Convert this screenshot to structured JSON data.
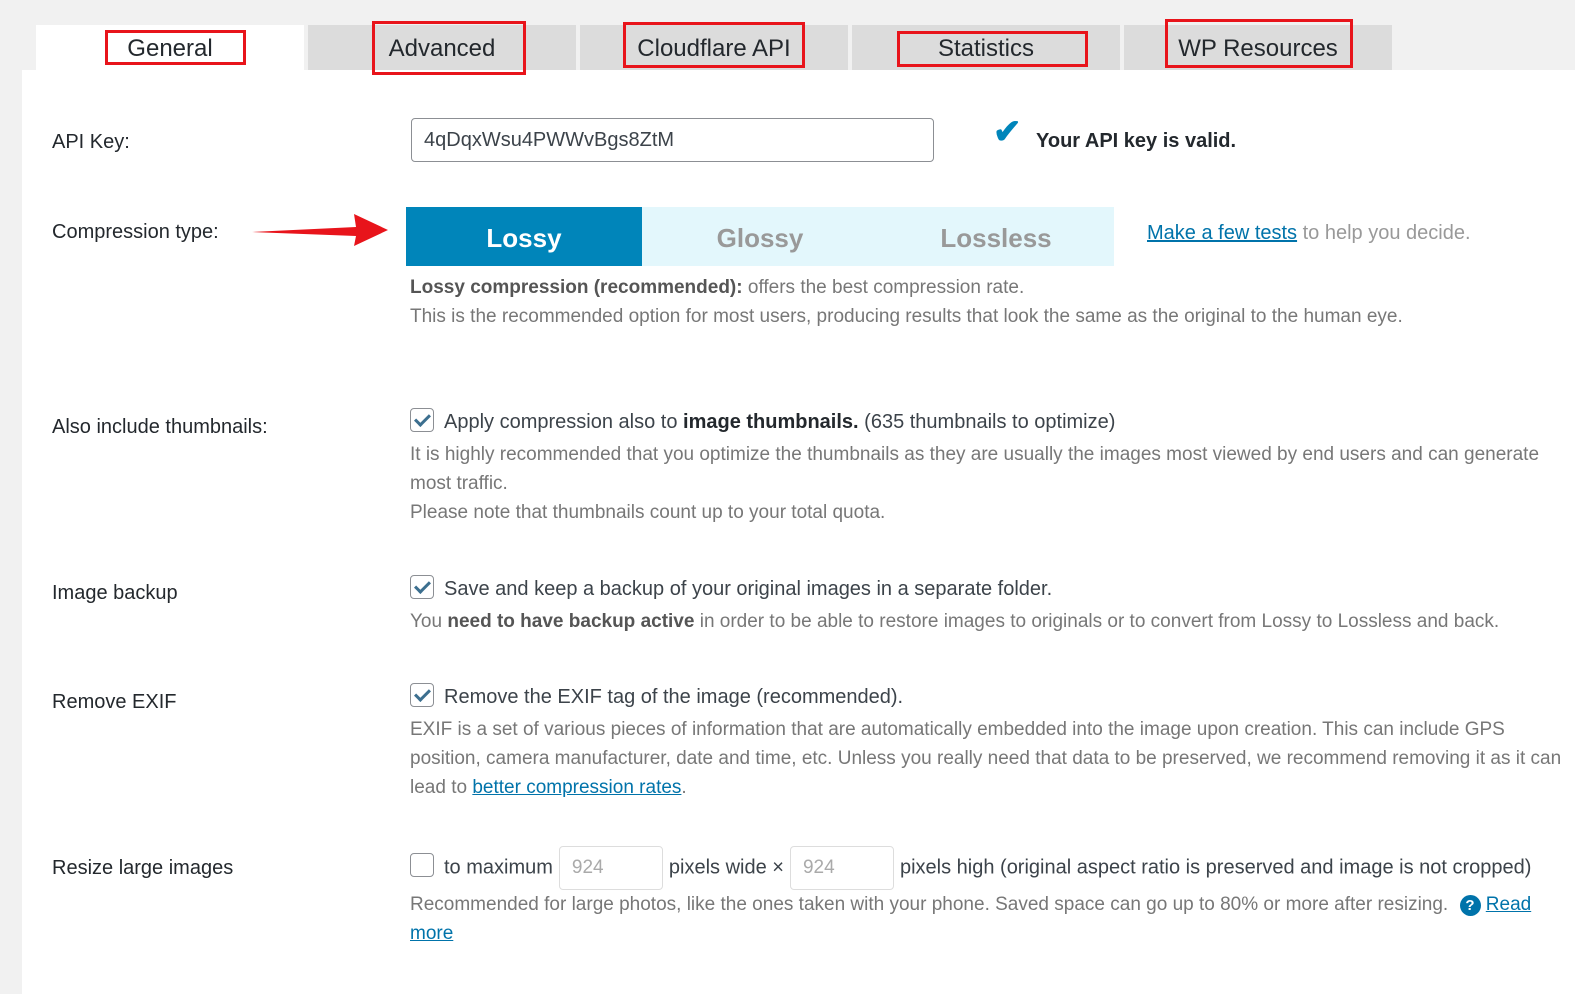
{
  "tabs": [
    "General",
    "Advanced",
    "Cloudflare API",
    "Statistics",
    "WP Resources"
  ],
  "api_key": {
    "label": "API Key:",
    "value": "4qDqxWsu4PWWvBgs8ZtM",
    "valid_text": "Your API key is valid."
  },
  "compression": {
    "label": "Compression type:",
    "options": [
      "Lossy",
      "Glossy",
      "Lossless"
    ],
    "selected": "Lossy",
    "link": "Make a few tests",
    "link_suffix": " to help you decide.",
    "desc_bold": "Lossy compression (recommended):",
    "desc_rest": " offers the best compression rate.",
    "desc2": "This is the recommended option for most users, producing results that look the same as the original to the human eye.",
    "accent": "#0085ba"
  },
  "thumbnails": {
    "label": "Also include thumbnails:",
    "checked": true,
    "text": "Apply compression also to ",
    "text_bold": "image thumbnails.",
    "count": " (635 thumbnails to optimize)",
    "desc": "It is highly recommended that you optimize the thumbnails as they are usually the images most viewed by end users and can generate most traffic.",
    "desc2": "Please note that thumbnails count up to your total quota."
  },
  "backup": {
    "label": "Image backup",
    "checked": true,
    "text": "Save and keep a backup of your original images in a separate folder.",
    "desc_pre": "You ",
    "desc_bold": "need to have backup active",
    "desc_post": " in order to be able to restore images to originals or to convert from Lossy to Lossless and back."
  },
  "exif": {
    "label": "Remove EXIF",
    "checked": true,
    "text": "Remove the EXIF tag of the image (recommended).",
    "desc": "EXIF is a set of various pieces of information that are automatically embedded into the image upon creation. This can include GPS position, camera manufacturer, date and time, etc. Unless you really need that data to be preserved, we recommend removing it as it can lead to ",
    "link": "better compression rates",
    "end": "."
  },
  "resize": {
    "label": "Resize large images",
    "checked": false,
    "pre": "to maximum",
    "width": "924",
    "mid": "pixels wide ×",
    "height": "924",
    "post": "pixels high (original aspect ratio is preserved and image is not cropped)",
    "desc": "Recommended for large photos, like the ones taken with your phone. Saved space can go up to 80% or more after resizing.",
    "link": "Read more"
  }
}
